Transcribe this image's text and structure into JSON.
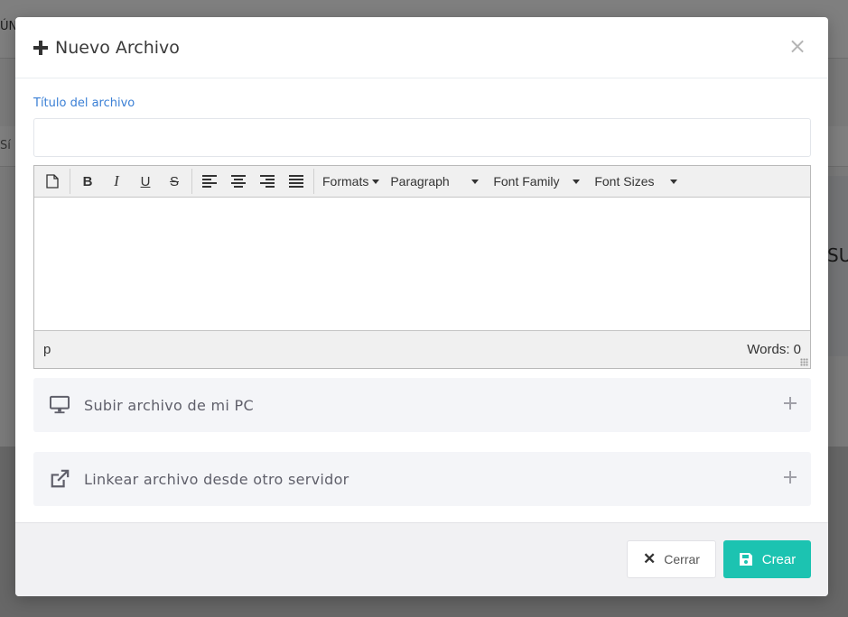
{
  "background": {
    "topbar_fragment": "ÚN",
    "row_fragment": "Sí",
    "panel_fragment": "SU"
  },
  "modal": {
    "title": "Nuevo Archivo",
    "close_symbol": "×",
    "title_field": {
      "label": "Título del archivo",
      "value": "",
      "placeholder": ""
    },
    "editor": {
      "toolbar": {
        "bold": "B",
        "italic": "I",
        "underline": "U",
        "strikethrough": "S",
        "formats": "Formats",
        "paragraph": "Paragraph",
        "font_family": "Font Family",
        "font_sizes": "Font Sizes"
      },
      "content": "",
      "status_path": "p",
      "word_count": "Words: 0"
    },
    "accordions": [
      {
        "label": "Subir archivo de mi PC",
        "icon": "monitor-icon"
      },
      {
        "label": "Linkear archivo desde otro servidor",
        "icon": "external-link-icon"
      }
    ],
    "footer": {
      "close_label": "Cerrar",
      "create_label": "Crear"
    }
  },
  "colors": {
    "accent_label": "#3a7fd5",
    "create_button": "#1cc3b1",
    "overlay": "rgba(0,0,0,0.5)"
  }
}
